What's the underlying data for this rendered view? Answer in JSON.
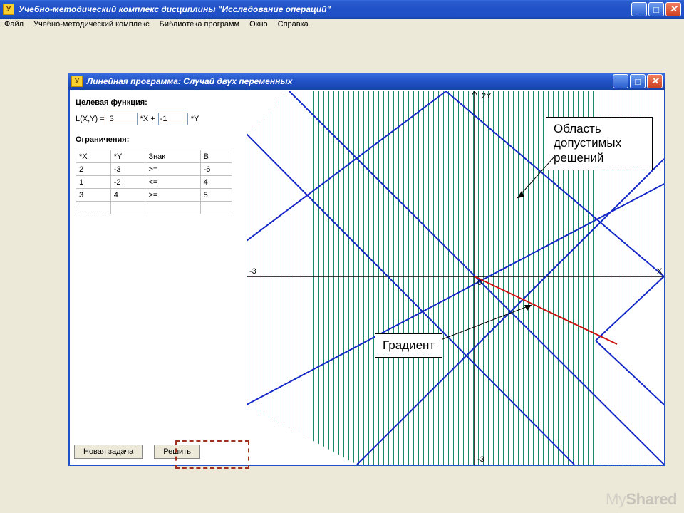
{
  "app": {
    "title": "Учебно-методический комплекс дисциплины \"Исследование операций\"",
    "icon_glyph": "У"
  },
  "menu": {
    "file": "Файл",
    "umk": "Учебно-методический комплекс",
    "library": "Библиотека программ",
    "window": "Окно",
    "help": "Справка"
  },
  "child": {
    "title": "Линейная программа: Случай двух переменных"
  },
  "objective": {
    "label": "Целевая функция:",
    "prefix": "L(X,Y) =",
    "coef_x": "3",
    "between": "*X +",
    "coef_y": "-1",
    "suffix": "*Y"
  },
  "constraints": {
    "label": "Ограничения:",
    "headers": {
      "x": "*X",
      "y": "*Y",
      "sign": "Знак",
      "b": "B"
    },
    "rows": [
      {
        "x": "2",
        "y": "-3",
        "sign": ">=",
        "b": "-6"
      },
      {
        "x": "1",
        "y": "-2",
        "sign": "<=",
        "b": "4"
      },
      {
        "x": "3",
        "y": "4",
        "sign": ">=",
        "b": "5"
      },
      {
        "x": "",
        "y": "",
        "sign": "",
        "b": ""
      }
    ]
  },
  "buttons": {
    "new": "Новая задача",
    "solve": "Решить"
  },
  "plot": {
    "y_label": "2Y",
    "x_origin": "0",
    "x_left": "-3",
    "x_right": "X",
    "y_bottom": "-3"
  },
  "annotations": {
    "feasible": "Область допустимых решений",
    "gradient": "Градиент"
  },
  "win_buttons": {
    "minimize": "_",
    "maximize": "□",
    "close": "✕"
  },
  "watermark": {
    "left": "My",
    "right": "Shared"
  }
}
